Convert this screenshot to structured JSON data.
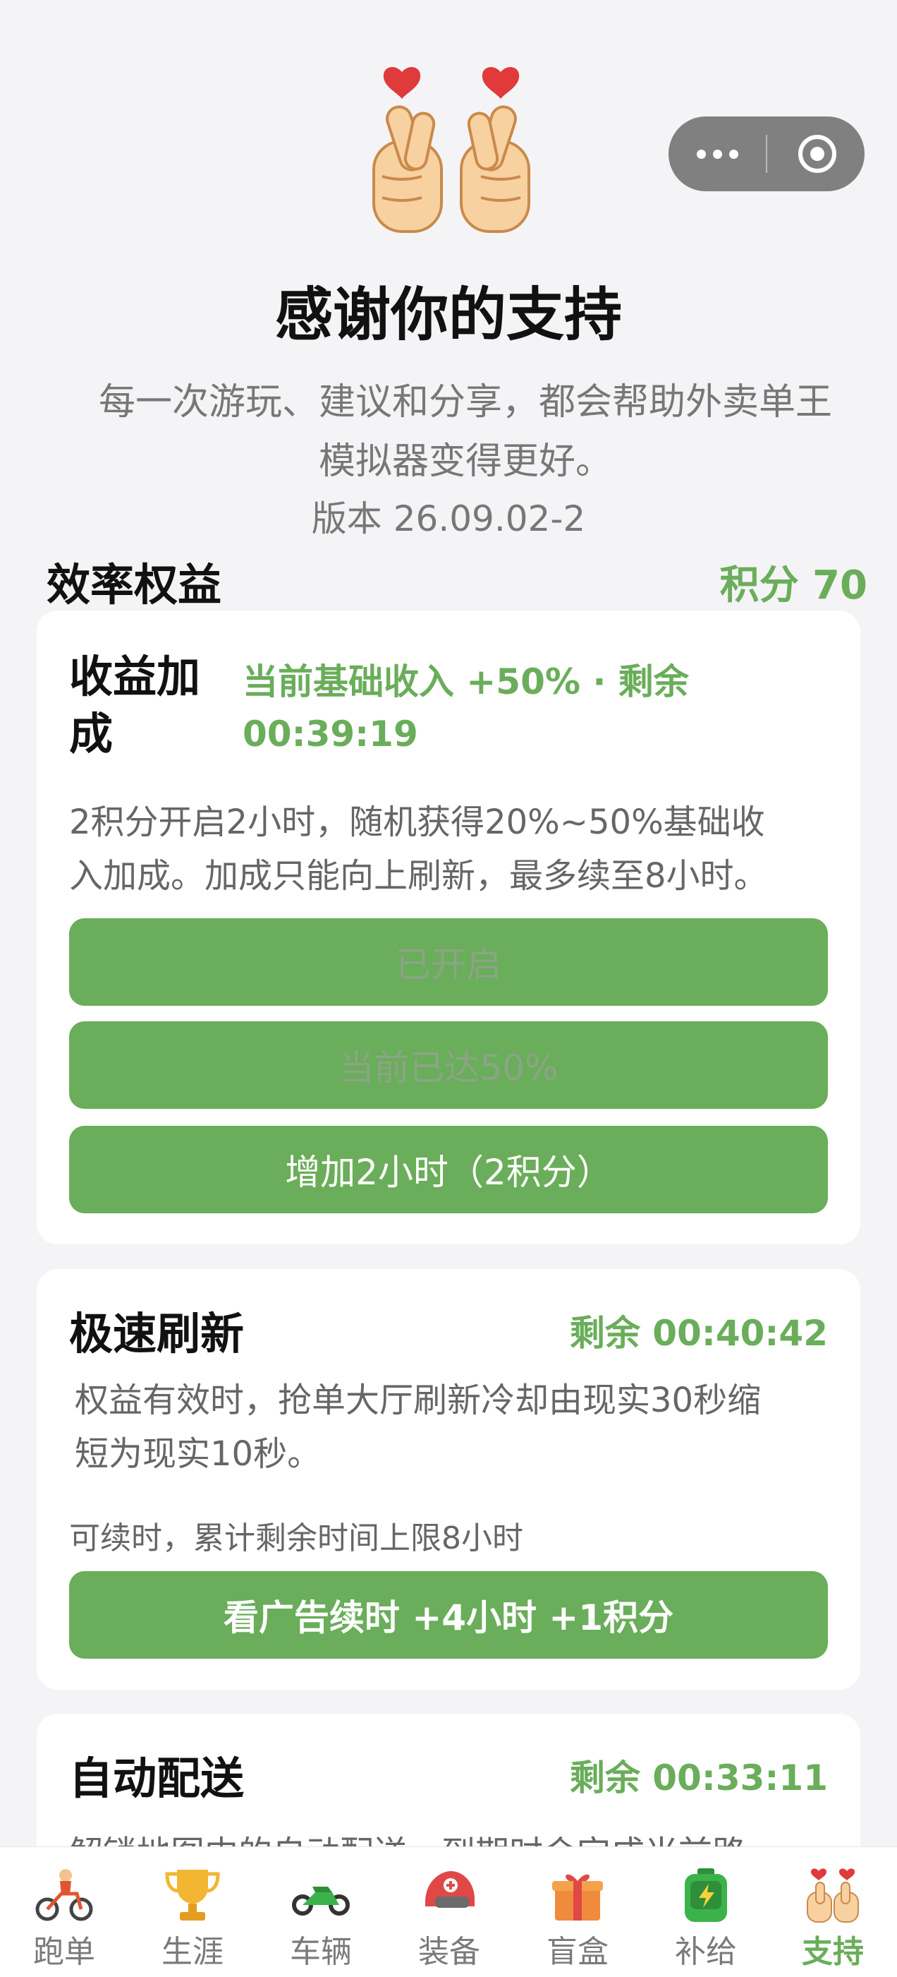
{
  "header": {
    "title": "感谢你的支持",
    "subtitle_line1": "每一次游玩、建议和分享，都会帮助外卖单王",
    "subtitle_line2": "模拟器变得更好。",
    "version": "版本 26.09.02-2"
  },
  "capsule": {
    "more_icon": "more-dots-icon",
    "close_icon": "target-circle-icon"
  },
  "section": {
    "title": "效率权益",
    "points": "积分 70"
  },
  "cards": [
    {
      "title_line1": "收益加",
      "title_line2": "成",
      "status_line1": "当前基础收入 +50% · 剩余",
      "status_line2": "00:39:19",
      "desc_line1": "2积分开启2小时，随机获得20%~50%基础收",
      "desc_line2": "入加成。加成只能向上刷新，最多续至8小时。",
      "buttons": [
        "已开启",
        "当前已达50%",
        "增加2小时（2积分）"
      ]
    },
    {
      "title": "极速刷新",
      "status": "剩余 00:40:42",
      "desc_line1": "权益有效时，抢单大厅刷新冷却由现实30秒缩",
      "desc_line2": "短为现实10秒。",
      "note": "可续时，累计剩余时间上限8小时",
      "button": "看广告续时 +4小时 +1积分"
    },
    {
      "title": "自动配送",
      "status": "剩余 00:33:11",
      "desc_line1": "解锁地图中的自动配送，到期时会完成当前路"
    }
  ],
  "tabs": [
    {
      "label": "跑单",
      "icon": "rider-icon"
    },
    {
      "label": "生涯",
      "icon": "trophy-icon"
    },
    {
      "label": "车辆",
      "icon": "motorcycle-icon"
    },
    {
      "label": "装备",
      "icon": "helmet-icon"
    },
    {
      "label": "盲盒",
      "icon": "gift-box-icon"
    },
    {
      "label": "补给",
      "icon": "battery-bag-icon"
    },
    {
      "label": "支持",
      "icon": "finger-heart-icon",
      "active": true
    }
  ],
  "colors": {
    "accent": "#6aad5a",
    "background": "#f4f4f6",
    "card": "#ffffff"
  }
}
